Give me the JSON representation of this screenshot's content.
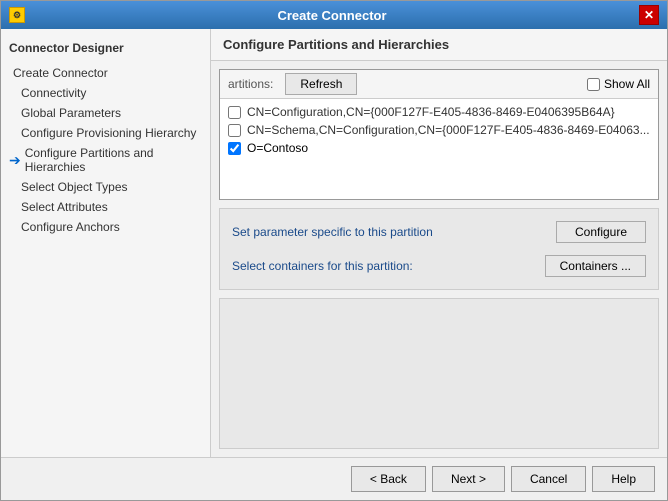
{
  "window": {
    "title": "Create Connector",
    "icon": "gear-icon",
    "close_label": "✕"
  },
  "sidebar": {
    "header": "Connector Designer",
    "items": [
      {
        "id": "create-connector",
        "label": "Create Connector",
        "active": false,
        "current": false,
        "indent": false
      },
      {
        "id": "connectivity",
        "label": "Connectivity",
        "active": false,
        "current": false,
        "indent": true
      },
      {
        "id": "global-parameters",
        "label": "Global Parameters",
        "active": false,
        "current": false,
        "indent": true
      },
      {
        "id": "configure-provisioning-hierarchy",
        "label": "Configure Provisioning Hierarchy",
        "active": false,
        "current": false,
        "indent": true
      },
      {
        "id": "configure-partitions",
        "label": "Configure Partitions and Hierarchies",
        "active": true,
        "current": true,
        "indent": true
      },
      {
        "id": "select-object-types",
        "label": "Select Object Types",
        "active": false,
        "current": false,
        "indent": true
      },
      {
        "id": "select-attributes",
        "label": "Select Attributes",
        "active": false,
        "current": false,
        "indent": true
      },
      {
        "id": "configure-anchors",
        "label": "Configure Anchors",
        "active": false,
        "current": false,
        "indent": true
      }
    ]
  },
  "panel": {
    "header": "Configure Partitions and Hierarchies",
    "partitions_label": "artitions:",
    "refresh_button": "Refresh",
    "show_all_label": "Show All",
    "partitions": [
      {
        "id": "p1",
        "label": "CN=Configuration,CN={000F127F-E405-4836-8469-E0406395B64A}",
        "checked": false
      },
      {
        "id": "p2",
        "label": "CN=Schema,CN=Configuration,CN={000F127F-E405-4836-8469-E04063...",
        "checked": false
      },
      {
        "id": "p3",
        "label": "O=Contoso",
        "checked": true
      }
    ],
    "set_parameter_label": "Set parameter specific to this partition",
    "configure_button": "Configure",
    "select_containers_label": "Select containers for this partition:",
    "containers_button": "Containers ..."
  },
  "footer": {
    "back_label": "< Back",
    "next_label": "Next >",
    "cancel_label": "Cancel",
    "help_label": "Help"
  }
}
